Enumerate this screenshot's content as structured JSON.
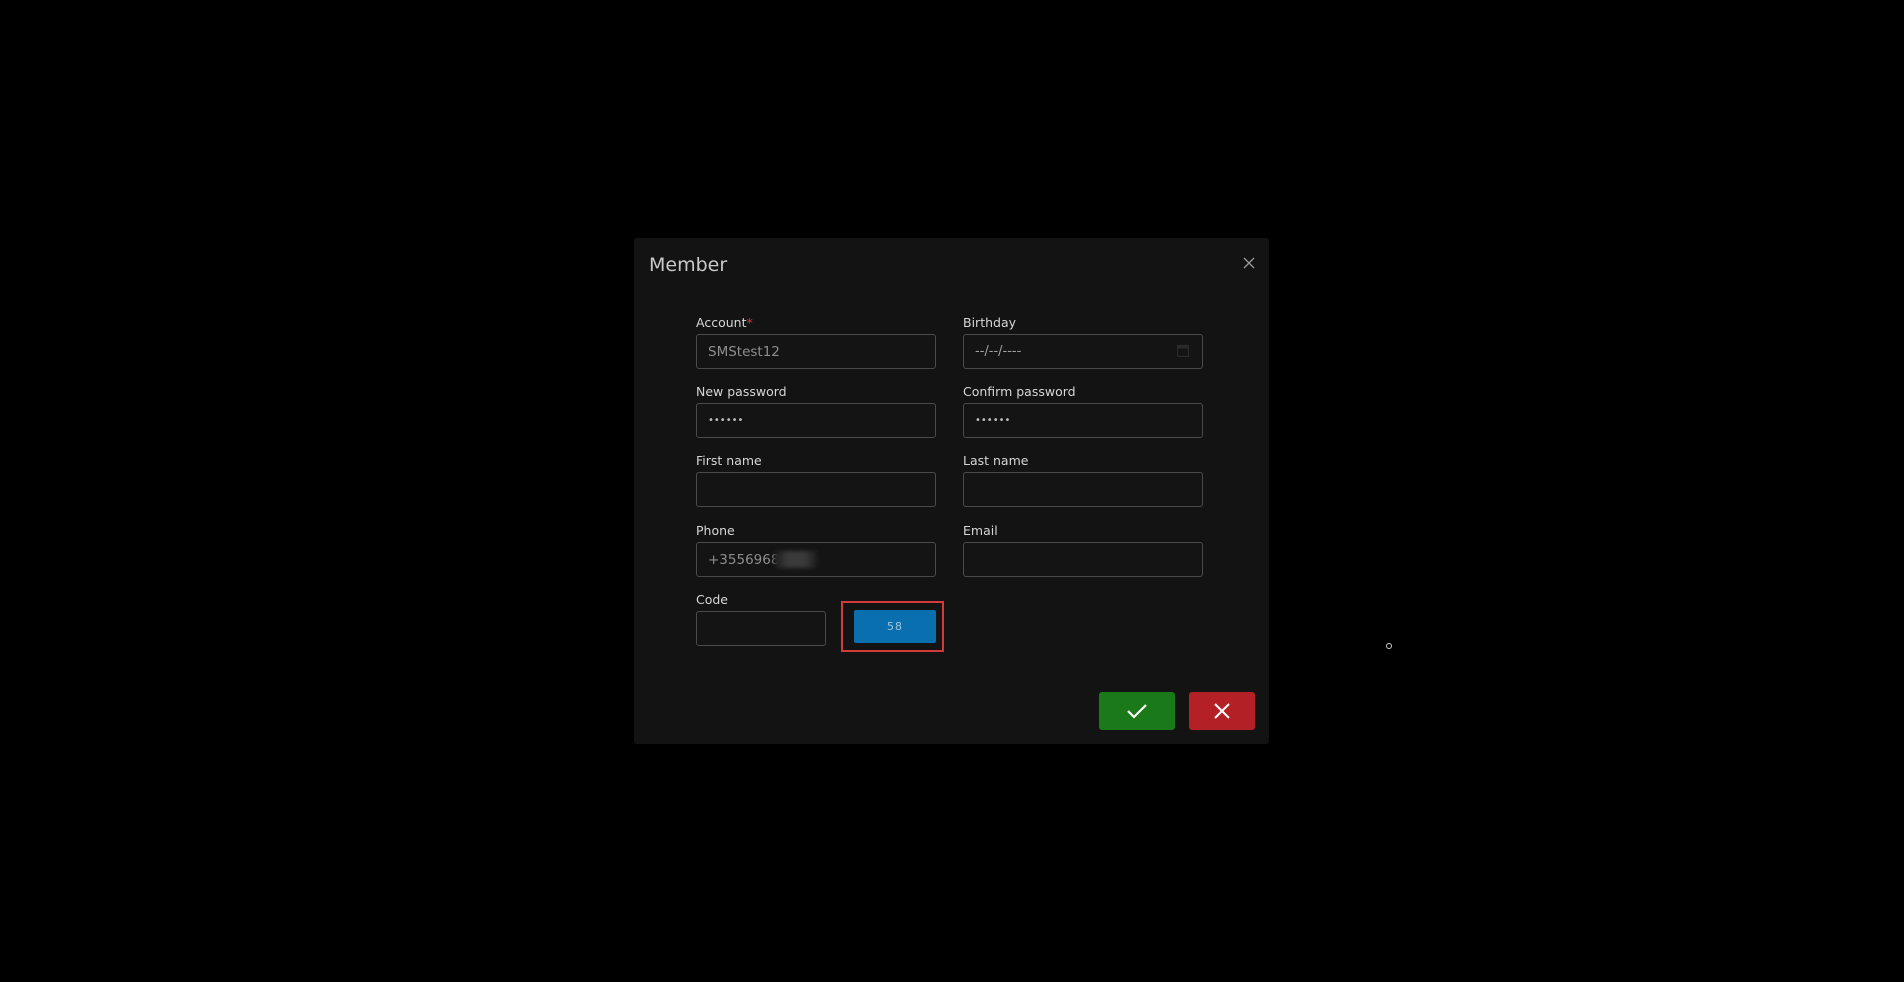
{
  "dialog": {
    "title": "Member"
  },
  "form": {
    "account": {
      "label": "Account",
      "required_mark": "*",
      "value": "SMStest12"
    },
    "birthday": {
      "label": "Birthday",
      "placeholder": "--/--/----"
    },
    "new_password": {
      "label": "New password",
      "masked_value": "••••••"
    },
    "confirm_password": {
      "label": "Confirm password",
      "masked_value": "••••••"
    },
    "first_name": {
      "label": "First name",
      "value": ""
    },
    "last_name": {
      "label": "Last name",
      "value": ""
    },
    "phone": {
      "label": "Phone",
      "value": "+3556968"
    },
    "email": {
      "label": "Email",
      "value": ""
    },
    "code": {
      "label": "Code",
      "value": ""
    },
    "send_code_button": {
      "label": "58"
    }
  },
  "actions": {
    "confirm_icon": "checkmark-icon",
    "cancel_icon": "close-icon"
  },
  "colors": {
    "confirm": "#1a7a1a",
    "cancel": "#b32025",
    "send_code": "#0a6fae",
    "highlight": "#d23b3b"
  }
}
